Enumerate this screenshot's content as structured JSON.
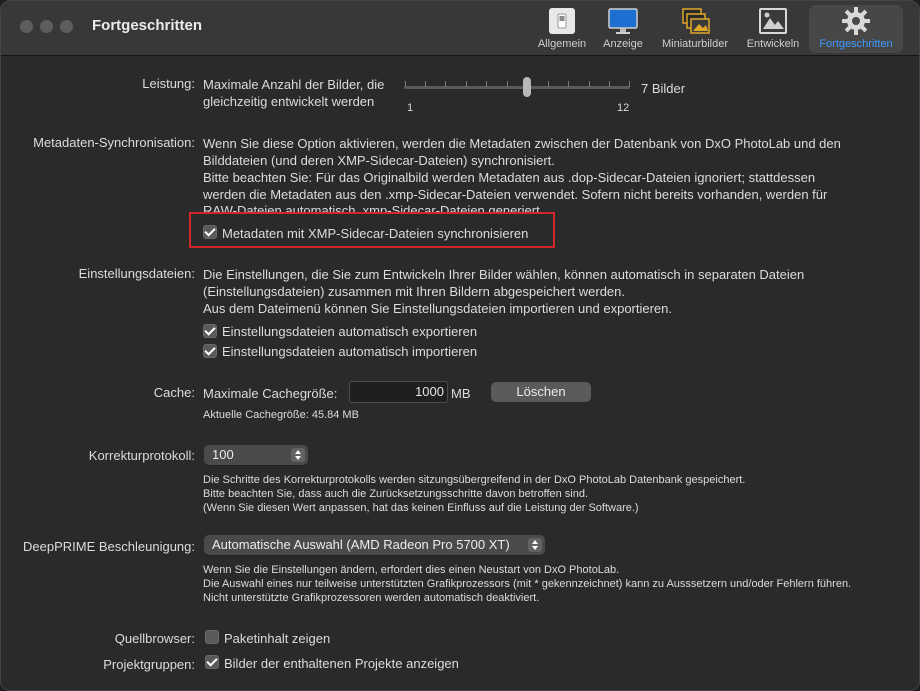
{
  "window": {
    "title": "Fortgeschritten"
  },
  "toolbar": [
    {
      "label": "Allgemein"
    },
    {
      "label": "Anzeige"
    },
    {
      "label": "Miniaturbilder"
    },
    {
      "label": "Entwickeln"
    },
    {
      "label": "Fortgeschritten"
    }
  ],
  "leistung": {
    "label": "Leistung:",
    "desc_line1": "Maximale Anzahl der Bilder, die",
    "desc_line2": "gleichzeitig entwickelt werden",
    "min": "1",
    "max": "12",
    "value_text": "7 Bilder",
    "value": 7
  },
  "metadaten": {
    "label": "Metadaten-Synchronisation:",
    "line1": "Wenn Sie diese Option aktivieren, werden die Metadaten zwischen der Datenbank von DxO PhotoLab und den",
    "line2": "Bilddateien (und deren XMP-Sidecar-Dateien) synchronisiert.",
    "line3": "Bitte beachten Sie: Für das Originalbild werden Metadaten aus .dop-Sidecar-Dateien ignoriert; stattdessen",
    "line4": "werden die Metadaten aus den .xmp-Sidecar-Dateien verwendet. Sofern nicht bereits vorhanden, werden für",
    "line5": "RAW-Dateien automatisch .xmp-Sidecar-Dateien generiert.",
    "checkbox_label": "Metadaten mit XMP-Sidecar-Dateien synchronisieren",
    "checked": true
  },
  "einstellungsdateien": {
    "label": "Einstellungsdateien:",
    "line1": "Die Einstellungen, die Sie zum Entwickeln Ihrer Bilder wählen, können automatisch in separaten Dateien",
    "line2": "(Einstellungsdateien) zusammen mit Ihren Bildern abgespeichert werden.",
    "line3": "Aus dem Dateimenü können Sie Einstellungsdateien importieren und exportieren.",
    "export_label": "Einstellungsdateien automatisch exportieren",
    "import_label": "Einstellungsdateien automatisch importieren"
  },
  "cache": {
    "label": "Cache:",
    "max_label": "Maximale Cachegröße:",
    "value": "1000",
    "unit": "MB",
    "clear_button": "Löschen",
    "current": "Aktuelle Cachegröße: 45.84 MB"
  },
  "korrektur": {
    "label": "Korrekturprotokoll:",
    "value": "100",
    "line1": "Die Schritte des Korrekturprotokolls werden sitzungsübergreifend in der DxO PhotoLab Datenbank gespeichert.",
    "line2": "Bitte beachten Sie, dass auch die Zurücksetzungsschritte davon betroffen sind.",
    "line3": "(Wenn Sie diesen Wert anpassen, hat das keinen Einfluss auf die Leistung der Software.)"
  },
  "deepprime": {
    "label": "DeepPRIME Beschleunigung:",
    "value": "Automatische Auswahl (AMD Radeon Pro 5700 XT)",
    "line1": "Wenn Sie die Einstellungen ändern, erfordert dies einen Neustart von DxO PhotoLab.",
    "line2": "Die Auswahl eines nur teilweise unterstützten Grafikprozessors (mit * gekennzeichnet) kann zu Ausssetzern und/oder Fehlern führen.",
    "line3": "Nicht unterstützte Grafikprozessoren werden automatisch deaktiviert."
  },
  "quellbrowser": {
    "label": "Quellbrowser:",
    "checkbox_label": "Paketinhalt zeigen",
    "checked": false
  },
  "projektgruppen": {
    "label": "Projektgruppen:",
    "checkbox_label": "Bilder der enthaltenen Projekte anzeigen",
    "checked": true
  }
}
